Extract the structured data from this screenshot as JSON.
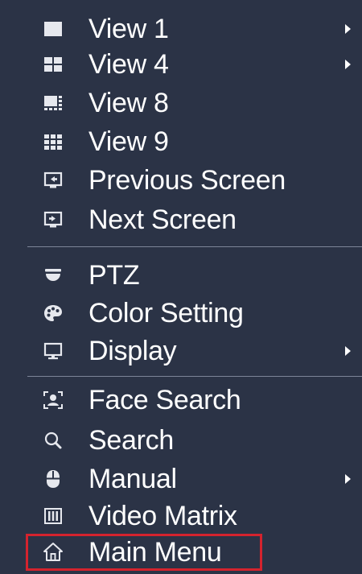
{
  "menu": {
    "items": [
      {
        "label": "View 1",
        "icon": "view1-icon",
        "has_submenu": true
      },
      {
        "label": "View 4",
        "icon": "view4-icon",
        "has_submenu": true
      },
      {
        "label": "View 8",
        "icon": "view8-icon",
        "has_submenu": false
      },
      {
        "label": "View 9",
        "icon": "view9-icon",
        "has_submenu": false
      },
      {
        "label": "Previous Screen",
        "icon": "previous-screen-icon",
        "has_submenu": false
      },
      {
        "label": "Next Screen",
        "icon": "next-screen-icon",
        "has_submenu": false
      },
      {
        "label": "PTZ",
        "icon": "ptz-icon",
        "has_submenu": false
      },
      {
        "label": "Color Setting",
        "icon": "palette-icon",
        "has_submenu": false
      },
      {
        "label": "Display",
        "icon": "monitor-icon",
        "has_submenu": true
      },
      {
        "label": "Face Search",
        "icon": "face-search-icon",
        "has_submenu": false
      },
      {
        "label": "Search",
        "icon": "search-icon",
        "has_submenu": false
      },
      {
        "label": "Manual",
        "icon": "mouse-icon",
        "has_submenu": true
      },
      {
        "label": "Video Matrix",
        "icon": "video-matrix-icon",
        "has_submenu": false
      },
      {
        "label": "Main Menu",
        "icon": "home-icon",
        "has_submenu": false,
        "highlighted": true
      }
    ]
  },
  "colors": {
    "background": "#2b3346",
    "text": "#ffffff",
    "divider": "#7d8597",
    "highlight_border": "#d4232e"
  }
}
